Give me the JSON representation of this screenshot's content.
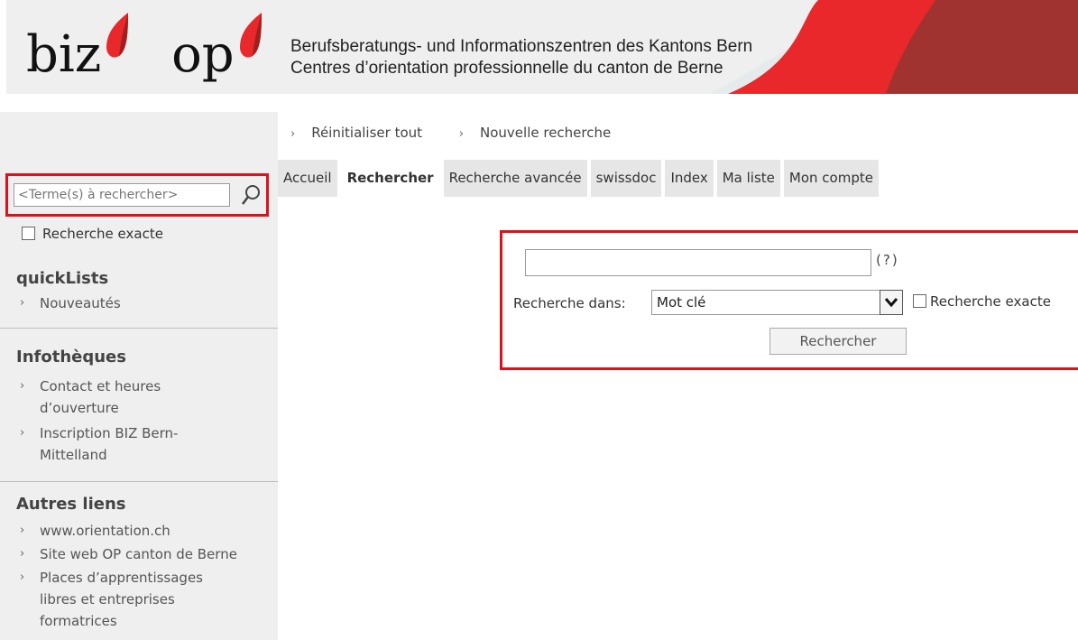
{
  "header": {
    "logo_left": "biz",
    "logo_right": "op",
    "line1": "Berufsberatungs- und Informationszentren des Kantons Bern",
    "line2": "Centres d’orientation professionnelle du canton de Berne"
  },
  "toplinks": [
    {
      "label": "Réinitialiser tout"
    },
    {
      "label": "Nouvelle recherche"
    }
  ],
  "tabs": [
    {
      "label": "Accueil",
      "active": false
    },
    {
      "label": "Rechercher",
      "active": true
    },
    {
      "label": "Recherche avancée",
      "active": false
    },
    {
      "label": "swissdoc",
      "active": false
    },
    {
      "label": "Index",
      "active": false
    },
    {
      "label": "Ma liste",
      "active": false
    },
    {
      "label": "Mon compte",
      "active": false
    }
  ],
  "sidebar": {
    "search_placeholder": "<Terme(s) à rechercher>",
    "exact_label": "Recherche exacte",
    "sections": [
      {
        "title": "quickLists",
        "links": [
          "Nouveautés"
        ]
      },
      {
        "title": "Infothèques",
        "links": [
          "Contact et heures d’ouverture",
          "Inscription BIZ Bern-Mittelland"
        ]
      },
      {
        "title": "Autres liens",
        "links": [
          "www.orientation.ch",
          "Site web OP canton de Berne",
          "Places d’apprentissages libres et entreprises formatrices"
        ]
      }
    ]
  },
  "main_search": {
    "query_value": "",
    "help": "(?)",
    "search_in_label": "Recherche dans:",
    "search_in_selected": "Mot clé",
    "exact_label": "Recherche exacte",
    "button_label": "Rechercher"
  },
  "colors": {
    "accent_red": "#e0101a",
    "brand_dark_red": "#a03230",
    "sidebar_bg": "#efefef"
  }
}
